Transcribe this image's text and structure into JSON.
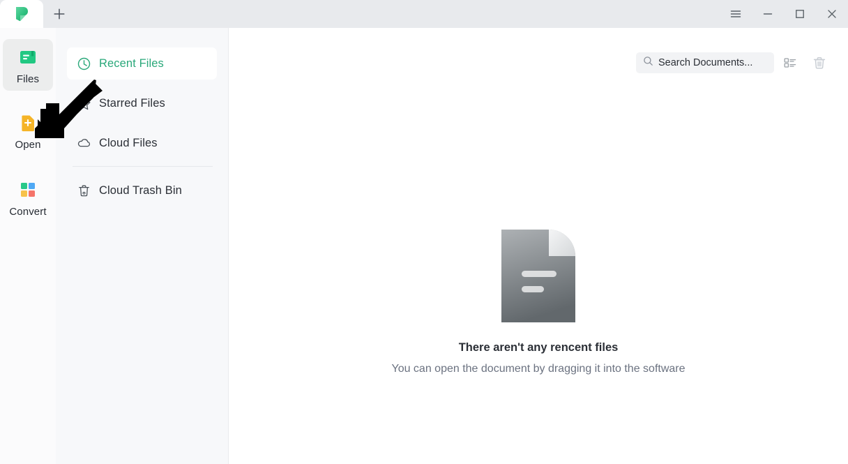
{
  "window": {
    "app_logo_icon": "wps-leaf-logo",
    "new_tab_icon": "plus-icon",
    "controls": [
      {
        "name": "menu-button",
        "icon": "hamburger-menu-icon"
      },
      {
        "name": "minimize-button",
        "icon": "minimize-icon"
      },
      {
        "name": "maximize-button",
        "icon": "maximize-square-icon"
      },
      {
        "name": "close-button",
        "icon": "close-x-icon"
      }
    ]
  },
  "rail": {
    "items": [
      {
        "label": "Files",
        "icon": "files-green-icon",
        "active": true
      },
      {
        "label": "Open",
        "icon": "open-plus-document-icon",
        "active": false
      },
      {
        "label": "Convert",
        "icon": "convert-grid-icon",
        "active": false
      }
    ]
  },
  "nav": {
    "items": [
      {
        "label": "Recent Files",
        "icon": "clock-icon",
        "active": true
      },
      {
        "label": "Starred Files",
        "icon": "star-icon",
        "active": false
      },
      {
        "label": "Cloud Files",
        "icon": "cloud-icon",
        "active": false
      }
    ],
    "trash": {
      "label": "Cloud Trash Bin",
      "icon": "trash-bin-icon",
      "active": false
    }
  },
  "main": {
    "search": {
      "placeholder": "Search Documents...",
      "value": "",
      "icon": "search-icon"
    },
    "view_toggle_icon": "list-view-icon",
    "trash_icon": "trash-bin-icon",
    "empty_state": {
      "doc_icon": "empty-document-icon",
      "title": "There aren't any rencent files",
      "subtitle": "You can open the document by dragging it into the software"
    }
  },
  "annotation": {
    "arrow_icon": "pointer-arrow-down-left",
    "target": "Open"
  },
  "colors": {
    "brand_green": "#2aa87a",
    "titlebar_bg": "#e8eaed",
    "nav_bg": "#f7f8fa",
    "rail_bg": "#fbfbfc",
    "main_bg": "#ffffff",
    "open_icon_amber": "#f5b427",
    "text_primary": "#2b2f36",
    "text_muted": "#6b7280"
  }
}
